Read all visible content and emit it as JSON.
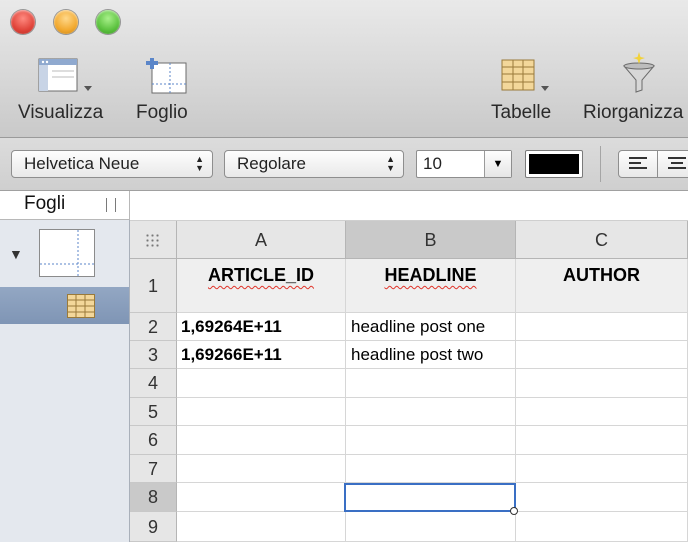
{
  "toolbar": {
    "view_label": "Visualizza",
    "sheet_label": "Foglio",
    "tables_label": "Tabelle",
    "reorganize_label": "Riorganizza"
  },
  "format_bar": {
    "font_family": "Helvetica Neue",
    "font_style": "Regolare",
    "font_size": "10",
    "text_color": "#000000"
  },
  "sidebar": {
    "title": "Fogli"
  },
  "grid": {
    "columns": [
      "A",
      "B",
      "C"
    ],
    "rows": [
      "1",
      "2",
      "3",
      "4",
      "5",
      "6",
      "7",
      "8",
      "9"
    ],
    "header_row": [
      "ARTICLE_ID",
      "HEADLINE",
      "AUTHOR"
    ],
    "data_rows": [
      [
        "1,69264E+11",
        "headline post one",
        ""
      ],
      [
        "1,69266E+11",
        "headline post two",
        ""
      ]
    ],
    "selected_cell": "B8"
  },
  "colors": {
    "selection": "#3a6fc4",
    "sidebar_selected": "#8a9fbd"
  }
}
